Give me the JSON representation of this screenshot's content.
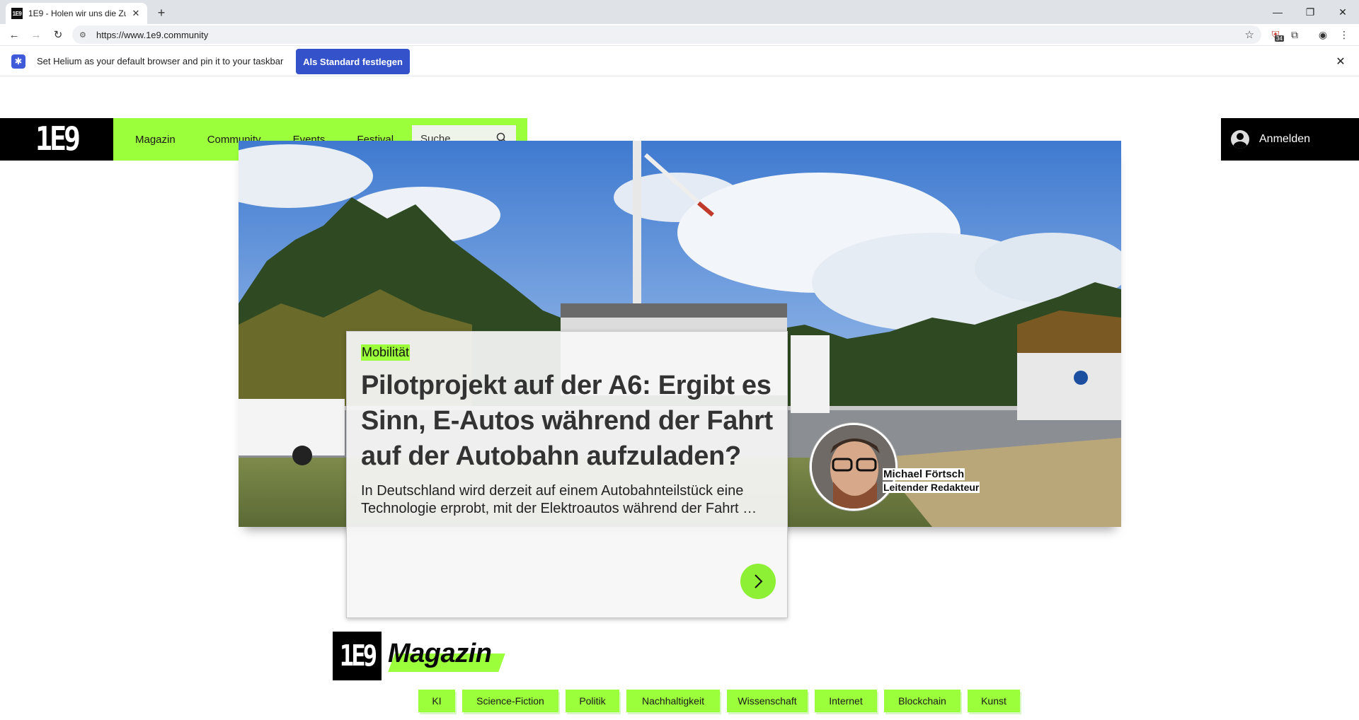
{
  "browser": {
    "tab_title": "1E9 - Holen wir uns die Zu",
    "favicon_text": "1E9",
    "url": "https://www.1e9.community",
    "extension_badge": "34"
  },
  "infobar": {
    "message": "Set Helium as your default browser and pin it to your taskbar",
    "button_label": "Als Standard festlegen"
  },
  "site": {
    "logo_text": "1E9",
    "nav": [
      "Magazin",
      "Community",
      "Events",
      "Festival"
    ],
    "search_placeholder": "Suche",
    "login_label": "Anmelden",
    "accent_color": "#9bff3b"
  },
  "hero": {
    "category": "Mobilität",
    "headline": "Pilotprojekt auf der A6: Ergibt es Sinn, E-Autos während der Fahrt auf der Autobahn aufzuladen?",
    "teaser": "In Deutschland wird derzeit auf einem Autobahnteilstück eine Technologie erprobt, mit der Elektroautos während der Fahrt …",
    "author_name": "Michael Förtsch",
    "author_role": "Leitender Redakteur"
  },
  "magazin": {
    "logo_text": "1E9",
    "title": "Magazin",
    "categories": [
      "KI",
      "Science-Fiction",
      "Politik",
      "Nachhaltigkeit",
      "Wissenschaft",
      "Internet",
      "Blockchain",
      "Kunst"
    ]
  }
}
